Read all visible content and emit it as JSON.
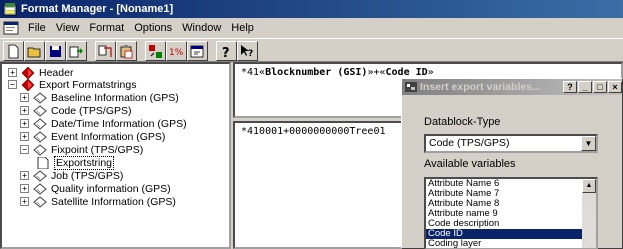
{
  "window": {
    "title": "Format Manager - [Noname1]"
  },
  "menu": [
    "File",
    "View",
    "Format",
    "Options",
    "Window",
    "Help"
  ],
  "tree": {
    "nodes": [
      {
        "label": "Header",
        "expander": "+",
        "icon": "red-diamond-icon"
      },
      {
        "label": "Export Formatstrings",
        "expander": "−",
        "icon": "red-diamond-icon"
      },
      {
        "label": "Baseline Information (GPS)",
        "expander": "+",
        "icon": "diamond-outline-icon"
      },
      {
        "label": "Code (TPS/GPS)",
        "expander": "+",
        "icon": "diamond-outline-icon"
      },
      {
        "label": "Date/Time Information (GPS)",
        "expander": "+",
        "icon": "diamond-outline-icon"
      },
      {
        "label": "Event Information (GPS)",
        "expander": "+",
        "icon": "diamond-outline-icon"
      },
      {
        "label": "Fixpoint (TPS/GPS)",
        "expander": "−",
        "icon": "diamond-outline-icon"
      },
      {
        "label": "Exportstring",
        "expander": "",
        "icon": "document-icon"
      },
      {
        "label": "Job (TPS/GPS)",
        "expander": "+",
        "icon": "diamond-outline-icon"
      },
      {
        "label": "Quality information (GPS)",
        "expander": "+",
        "icon": "diamond-outline-icon"
      },
      {
        "label": "Satellite Information (GPS)",
        "expander": "+",
        "icon": "diamond-outline-icon"
      }
    ]
  },
  "editor": {
    "format_prefix": "*41«",
    "format_bold": "Blocknumber (GSI)",
    "format_mid": "»+«",
    "format_bold2": "Code ID",
    "format_suffix": "»",
    "preview": "*410001+0000000000Tree01"
  },
  "dialog": {
    "title": "Insert export variables...",
    "datablock_label": "Datablock-Type",
    "datablock_value": "Code (TPS/GPS)",
    "variables_label": "Available variables",
    "variables": [
      "Attribute Name 6",
      "Attribute Name 7",
      "Attribute Name 8",
      "Attribute name 9",
      "Code description",
      "Code ID",
      "Coding layer"
    ],
    "selected_variable": "Code ID",
    "title_buttons": [
      "?",
      "_",
      "□",
      "×"
    ]
  }
}
